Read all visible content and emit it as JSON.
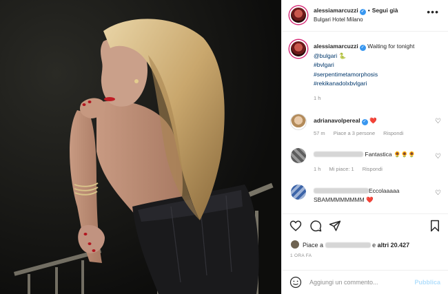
{
  "post": {
    "username": "alessiamarcuzzi",
    "follow_separator": "•",
    "follow_label": "Segui già",
    "location": "Bulgari Hotel Milano",
    "more_label": "•••"
  },
  "caption": {
    "username": "alessiamarcuzzi",
    "text": "Waiting for tonight",
    "mention": "@bulgari",
    "emoji": "🐍",
    "hashtags": [
      "#bvlgari",
      "#serpentimetamorphosis",
      "#rekikanadolxbvlgari"
    ],
    "time": "1 h"
  },
  "comments": [
    {
      "username": "adrianavolpereal",
      "text": "❤️",
      "meta": [
        "57 m",
        "Piace a 3 persone",
        "Rispondi"
      ]
    },
    {
      "username": "",
      "text": "Fantastica 🌻🌻🌻",
      "meta": [
        "1 h",
        "Mi piace: 1",
        "Rispondi"
      ]
    },
    {
      "username": "",
      "text": "Eccolaaaaa",
      "text2": "SBAMMMMMMMM ❤️",
      "meta": []
    }
  ],
  "likes": {
    "prefix": "Piace a",
    "middle": "e",
    "count": "altri 20.427"
  },
  "date_label": "1 ORA FA",
  "add_comment": {
    "placeholder": "Aggiungi un commento...",
    "publish_label": "Pubblica"
  },
  "icons": {
    "verified": "verified-badge-icon",
    "like": "heart-icon",
    "comment": "comment-icon",
    "share": "share-icon",
    "save": "bookmark-icon",
    "emoji": "smiley-icon"
  },
  "colors": {
    "link": "#00376b",
    "verified": "#3897f0",
    "muted": "#8e8e8e",
    "publish": "#b2dffc",
    "red_heart": "#ed4956"
  }
}
